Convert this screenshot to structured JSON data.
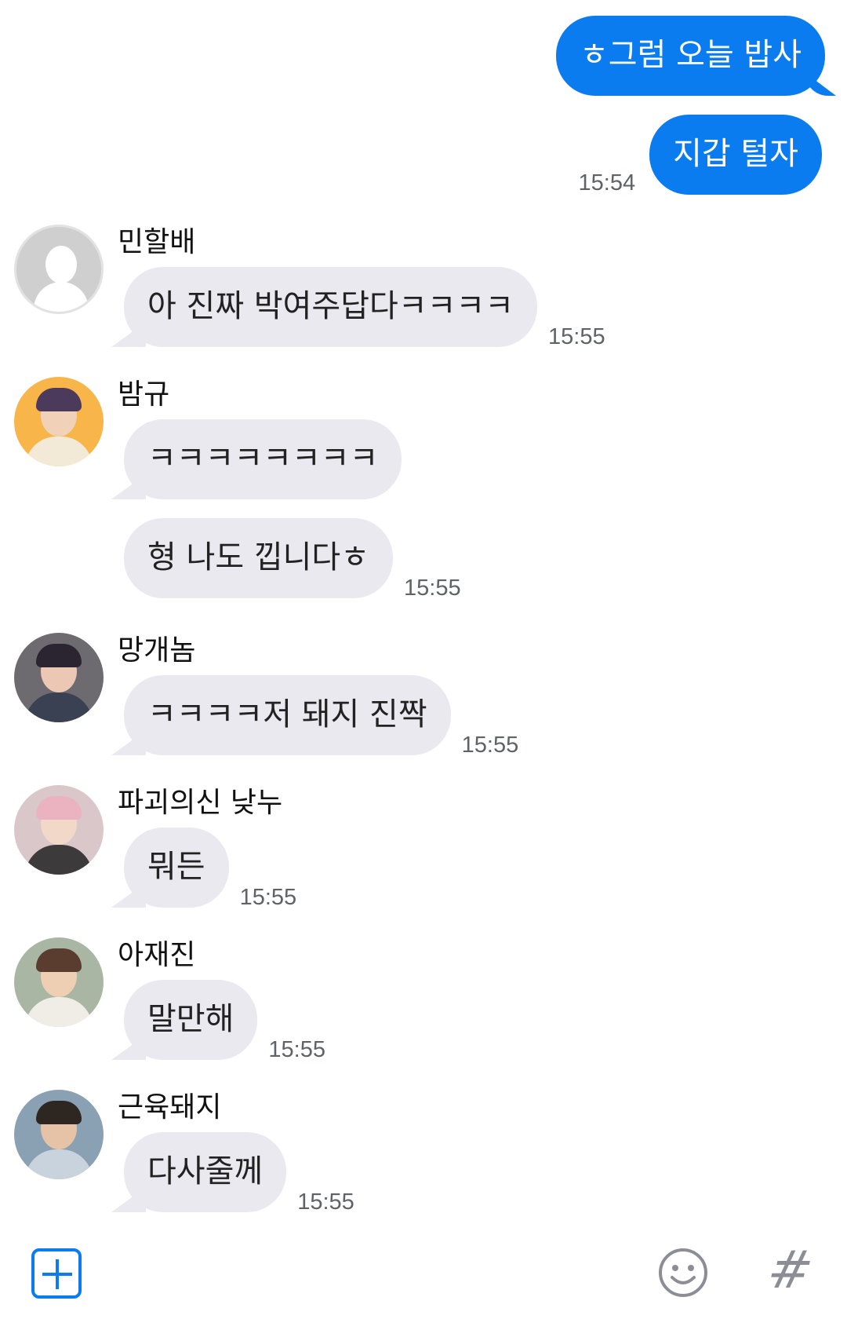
{
  "messages_out": [
    {
      "text": "ㅎ그럼 오늘 밥사"
    },
    {
      "text": "지갑 털자",
      "time": "15:54"
    }
  ],
  "messages_in": [
    {
      "sender": "민할배",
      "bubbles": [
        "아 진짜 박여주답다ㅋㅋㅋㅋ"
      ],
      "time": "15:55",
      "avatar": "default-avatar"
    },
    {
      "sender": "밤규",
      "bubbles": [
        "ㅋㅋㅋㅋㅋㅋㅋㅋ",
        "형 나도 낍니다ㅎ"
      ],
      "time": "15:55",
      "avatar": "photo-avatar"
    },
    {
      "sender": "망개놈",
      "bubbles": [
        "ㅋㅋㅋㅋ저 돼지 진짝"
      ],
      "time": "15:55",
      "avatar": "photo-avatar"
    },
    {
      "sender": "파괴의신 낮누",
      "bubbles": [
        "뭐든"
      ],
      "time": "15:55",
      "avatar": "photo-avatar"
    },
    {
      "sender": "아재진",
      "bubbles": [
        "말만해"
      ],
      "time": "15:55",
      "avatar": "photo-avatar"
    },
    {
      "sender": "근육돼지",
      "bubbles": [
        "다사줄께"
      ],
      "time": "15:55",
      "avatar": "photo-avatar"
    }
  ],
  "bottom_bar": {
    "icons": [
      "plus-icon",
      "emoji-icon",
      "hashtag-icon"
    ],
    "hash_glyph": "#"
  },
  "colors": {
    "outgoing_bubble": "#0a7cf0",
    "incoming_bubble": "#e9e9ef",
    "timestamp": "#5f6368"
  }
}
